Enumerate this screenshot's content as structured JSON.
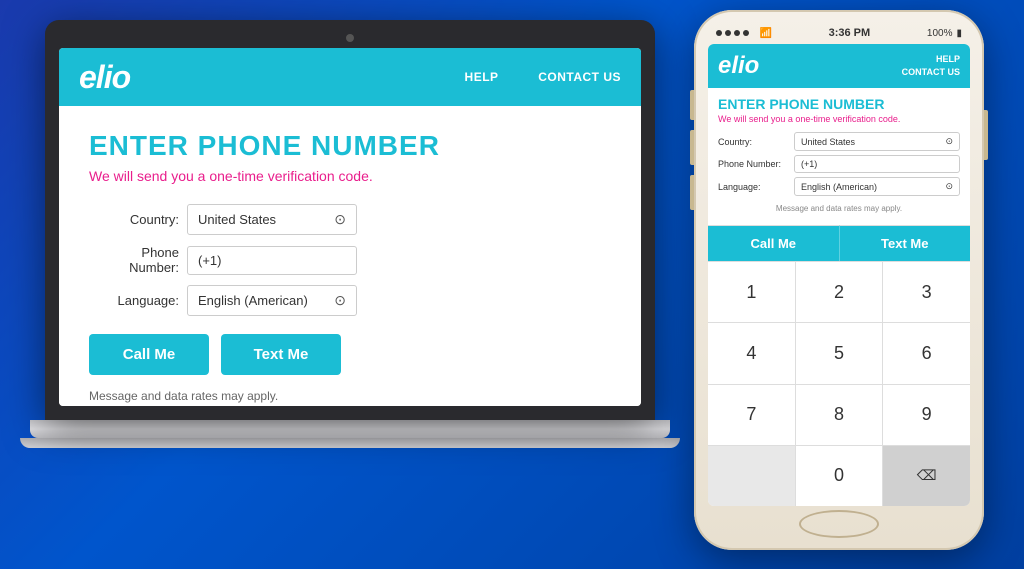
{
  "background": "#1a3aad",
  "laptop": {
    "nav": {
      "logo": "elio",
      "links": [
        "HELP",
        "CONTACT US"
      ]
    },
    "content": {
      "heading": "ENTER PHONE NUMBER",
      "subtitle": "We will send you a one-time verification code.",
      "form": {
        "country_label": "Country:",
        "country_value": "United States",
        "phone_label": "Phone Number:",
        "phone_value": "(+1)",
        "language_label": "Language:",
        "language_value": "English (American)"
      },
      "buttons": {
        "call": "Call Me",
        "text": "Text Me"
      },
      "disclaimer": "Message and data rates may apply."
    }
  },
  "phone": {
    "status_bar": {
      "dots": 4,
      "time": "3:36 PM",
      "battery": "100%"
    },
    "nav": {
      "logo": "elio",
      "links": [
        "HELP",
        "CONTACT US"
      ]
    },
    "content": {
      "heading": "ENTER PHONE NUMBER",
      "subtitle": "We will send you a one-time verification code.",
      "form": {
        "country_label": "Country:",
        "country_value": "United States",
        "phone_label": "Phone Number:",
        "phone_value": "(+1)",
        "language_label": "Language:",
        "language_value": "English (American)"
      },
      "disclaimer": "Message and data rates may apply."
    },
    "keypad": {
      "action_row": [
        "Call Me",
        "Text Me"
      ],
      "rows": [
        [
          "1",
          "2",
          "3"
        ],
        [
          "4",
          "5",
          "6"
        ],
        [
          "7",
          "8",
          "9"
        ],
        [
          "",
          "0",
          "⌫"
        ]
      ]
    }
  }
}
